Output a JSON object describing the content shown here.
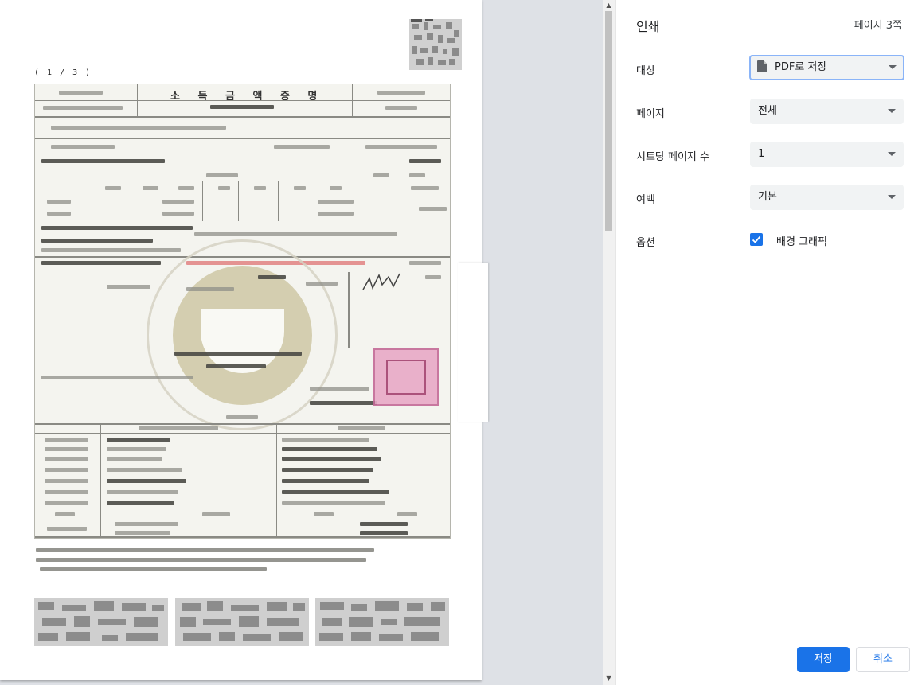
{
  "preview": {
    "page_indicator": "( 1 / 3 )",
    "document_title": "소 득 금 액 증 명"
  },
  "settings": {
    "title": "인쇄",
    "page_count": "페이지 3쪽",
    "destination": {
      "label": "대상",
      "value": "PDF로 저장",
      "icon": "file-icon"
    },
    "pages": {
      "label": "페이지",
      "value": "전체"
    },
    "pages_per_sheet": {
      "label": "시트당 페이지 수",
      "value": "1"
    },
    "margins": {
      "label": "여백",
      "value": "기본"
    },
    "options": {
      "label": "옵션",
      "checkbox_label": "배경 그래픽",
      "checked": true
    },
    "save_label": "저장",
    "cancel_label": "취소"
  },
  "colors": {
    "accent": "#1a73e8",
    "focus": "#8ab4f8",
    "select_bg": "#f1f3f4"
  }
}
